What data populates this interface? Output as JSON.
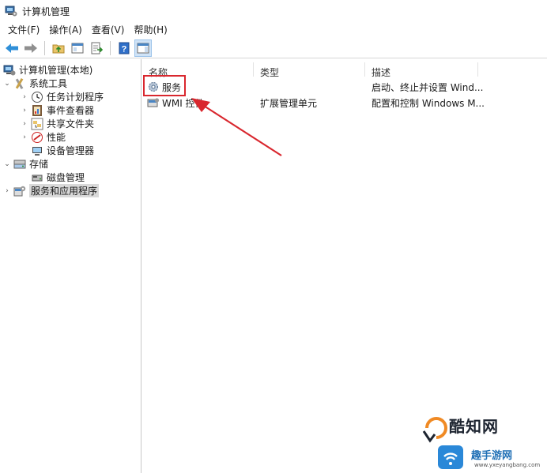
{
  "window": {
    "title": "计算机管理"
  },
  "menubar": {
    "items": [
      "文件(F)",
      "操作(A)",
      "查看(V)",
      "帮助(H)"
    ]
  },
  "toolbar": {
    "buttons": [
      "back-icon",
      "forward-icon",
      "up-folder-icon",
      "show-hide-tree-icon",
      "export-list-icon",
      "help-icon",
      "action-pane-icon"
    ]
  },
  "tree": {
    "root": "计算机管理(本地)",
    "system_tools": "系统工具",
    "task_scheduler": "任务计划程序",
    "event_viewer": "事件查看器",
    "shared_folders": "共享文件夹",
    "performance": "性能",
    "device_manager": "设备管理器",
    "storage": "存储",
    "disk_management": "磁盘管理",
    "services_apps": "服务和应用程序"
  },
  "list": {
    "columns": [
      "名称",
      "类型",
      "描述"
    ],
    "rows": [
      {
        "name": "服务",
        "type": "",
        "desc": "启动、终止并设置 Wind..."
      },
      {
        "name": "WMI 控件",
        "type": "扩展管理单元",
        "desc": "配置和控制 Windows M..."
      }
    ]
  },
  "watermark": {
    "brand": "酷知网",
    "site_cn": "趣手游网",
    "url": "www.yxeyangbang.com"
  },
  "colors": {
    "highlight": "#d9272e",
    "selection": "#d9d9d9",
    "accent": "#1f6fb5"
  }
}
